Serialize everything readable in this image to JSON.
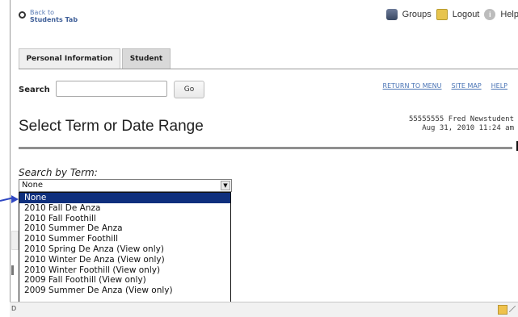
{
  "header": {
    "back_line1": "Back to",
    "back_line2": "Students Tab",
    "groups": "Groups",
    "logout": "Logout",
    "help": "Help"
  },
  "tabs": {
    "personal_information": "Personal Information",
    "student": "Student"
  },
  "search": {
    "label": "Search",
    "value": "",
    "go": "Go"
  },
  "links": {
    "return_to_menu": "RETURN TO MENU",
    "site_map": "SITE MAP",
    "help": "HELP"
  },
  "page": {
    "title": "Select Term or Date Range",
    "student_id_name": "55555555 Fred Newstudent",
    "timestamp": "Aug 31, 2010 11:24 am"
  },
  "term_search": {
    "label": "Search by Term:",
    "selected": "None",
    "options": [
      "None",
      "2010 Fall De Anza",
      "2010 Fall Foothill",
      "2010 Summer De Anza",
      "2010 Summer Foothill",
      "2010 Spring De Anza (View only)",
      "2010 Winter De Anza (View only)",
      "2010 Winter Foothill (View only)",
      "2009 Fall Foothill (View only)",
      "2009 Summer De Anza (View only)"
    ]
  },
  "status": {
    "left_letter": "D"
  },
  "colors": {
    "link": "#4a74b5",
    "dropdown_selected": "#0f2f7d",
    "arrow": "#2f47c2"
  }
}
